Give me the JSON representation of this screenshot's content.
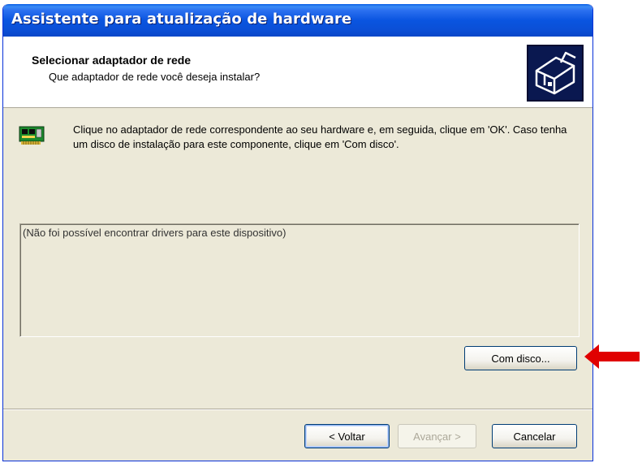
{
  "window": {
    "title": "Assistente para atualização de hardware"
  },
  "header": {
    "title": "Selecionar adaptador de rede",
    "subtitle": "Que adaptador de rede você deseja instalar?",
    "icon": "network-adapter-hardware-icon"
  },
  "instructions": {
    "icon": "network-card-icon",
    "text": "Clique no adaptador de rede correspondente ao seu hardware e, em seguida, clique em 'OK'. Caso tenha um disco de instalação para este componente, clique em 'Com disco'."
  },
  "driver_list": {
    "message": "(Não foi possível encontrar drivers para este dispositivo)"
  },
  "buttons": {
    "have_disk": "Com disco...",
    "back": "< Voltar",
    "next": "Avançar >",
    "cancel": "Cancelar"
  },
  "annotation": {
    "arrow_color": "#e00000"
  },
  "colors": {
    "titlebar": "#0a55e0",
    "dialog_bg": "#ece9d8",
    "button_border": "#003c74"
  }
}
